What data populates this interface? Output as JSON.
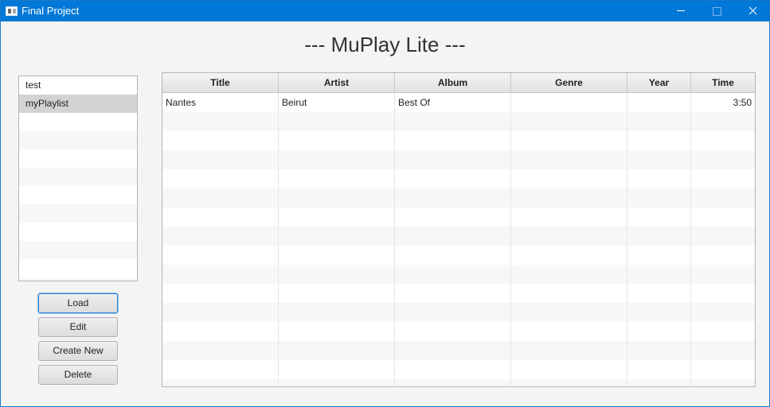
{
  "window": {
    "title": "Final Project",
    "icon": "app-window-icon",
    "controls": [
      "minimize-icon",
      "maximize-icon",
      "close-icon"
    ]
  },
  "app_title": "--- MuPlay Lite ---",
  "playlists": {
    "items": [
      {
        "label": "test",
        "selected": false
      },
      {
        "label": "myPlaylist",
        "selected": true
      }
    ]
  },
  "buttons": {
    "load": "Load",
    "edit": "Edit",
    "create_new": "Create New",
    "delete": "Delete"
  },
  "table": {
    "columns": [
      "Title",
      "Artist",
      "Album",
      "Genre",
      "Year",
      "Time"
    ],
    "rows": [
      [
        "Nantes",
        "Beirut",
        "Best Of",
        "",
        "",
        "3:50"
      ]
    ]
  },
  "colors": {
    "titlebar": "#0078d7",
    "focus": "#2b7fd1"
  }
}
